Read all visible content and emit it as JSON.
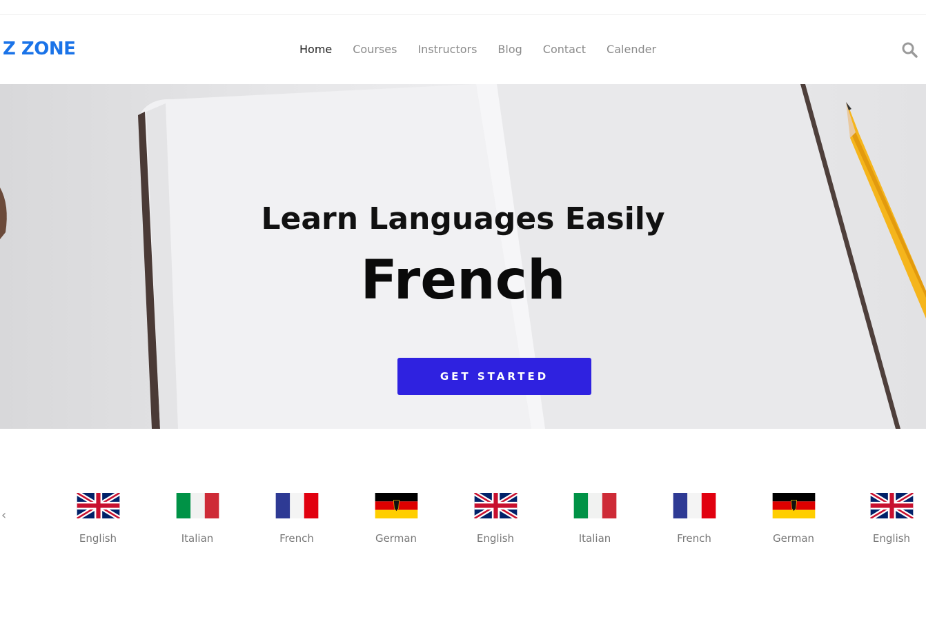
{
  "logo": "Z ZONE",
  "nav": {
    "items": [
      {
        "label": "Home",
        "active": true
      },
      {
        "label": "Courses",
        "active": false
      },
      {
        "label": "Instructors",
        "active": false
      },
      {
        "label": "Blog",
        "active": false
      },
      {
        "label": "Contact",
        "active": false
      },
      {
        "label": "Calender",
        "active": false
      }
    ],
    "search_icon": "search-icon"
  },
  "hero": {
    "title": "Learn Languages Easily",
    "language": "French",
    "cta_label": "GET STARTED",
    "cta_color": "#2f22e0"
  },
  "languages": [
    {
      "label": "English",
      "flag": "uk"
    },
    {
      "label": "Italian",
      "flag": "italy"
    },
    {
      "label": "French",
      "flag": "france"
    },
    {
      "label": "German",
      "flag": "germany"
    },
    {
      "label": "English",
      "flag": "uk"
    },
    {
      "label": "Italian",
      "flag": "italy"
    },
    {
      "label": "French",
      "flag": "france"
    },
    {
      "label": "German",
      "flag": "germany"
    },
    {
      "label": "English",
      "flag": "uk"
    }
  ],
  "carousel": {
    "prev_icon": "chevron-left-icon"
  },
  "colors": {
    "brand": "#1a73e8",
    "accent": "#2f22e0"
  }
}
